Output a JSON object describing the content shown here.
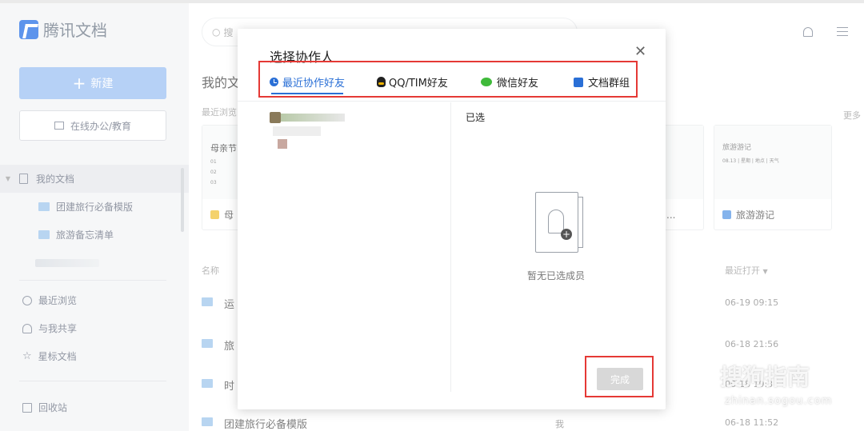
{
  "app": {
    "name": "腾讯文档"
  },
  "sidebar": {
    "new_label": "新建",
    "office_label": "在线办公/教育",
    "my_docs": "我的文档",
    "folders": [
      "团建旅行必备模版",
      "旅游备忘清单"
    ],
    "nav": [
      "最近浏览",
      "与我共享",
      "星标文档"
    ],
    "trash": "回收站"
  },
  "main": {
    "search_placeholder": "搜",
    "title": "我的文",
    "recent_label": "最近浏览",
    "more": "更多",
    "cards": [
      {
        "preview_title": "母亲节",
        "preview_lines": [
          "01",
          "02",
          "03"
        ],
        "name": "母"
      },
      {
        "preview_title": "",
        "name": "团..."
      },
      {
        "preview_title": "旅游游记",
        "preview_sub": "08.13 | 星期 | 地点 | 天气",
        "name": "旅游游记"
      }
    ],
    "col_name": "名称",
    "col_open": "最近打开",
    "rows": [
      {
        "name": "运",
        "owner": "",
        "date": "06-19 09:15"
      },
      {
        "name": "旅",
        "owner": "",
        "date": "06-18 21:56"
      },
      {
        "name": "时",
        "owner": "",
        "date": "06-18 19:3"
      },
      {
        "name": "团建旅行必备模版",
        "owner": "我",
        "date": "06-18 11:52"
      }
    ]
  },
  "dialog": {
    "title": "选择协作人",
    "tabs": [
      "最近协作好友",
      "QQ/TIM好友",
      "微信好友",
      "文档群组"
    ],
    "selected_label": "已选",
    "empty_text": "暂无已选成员",
    "done_label": "完成"
  },
  "watermark": {
    "main": "搜狗指南",
    "sub": "zhinan.sogou.com"
  },
  "colors": {
    "accent": "#2a6fd6",
    "highlight_border": "#e53935"
  }
}
